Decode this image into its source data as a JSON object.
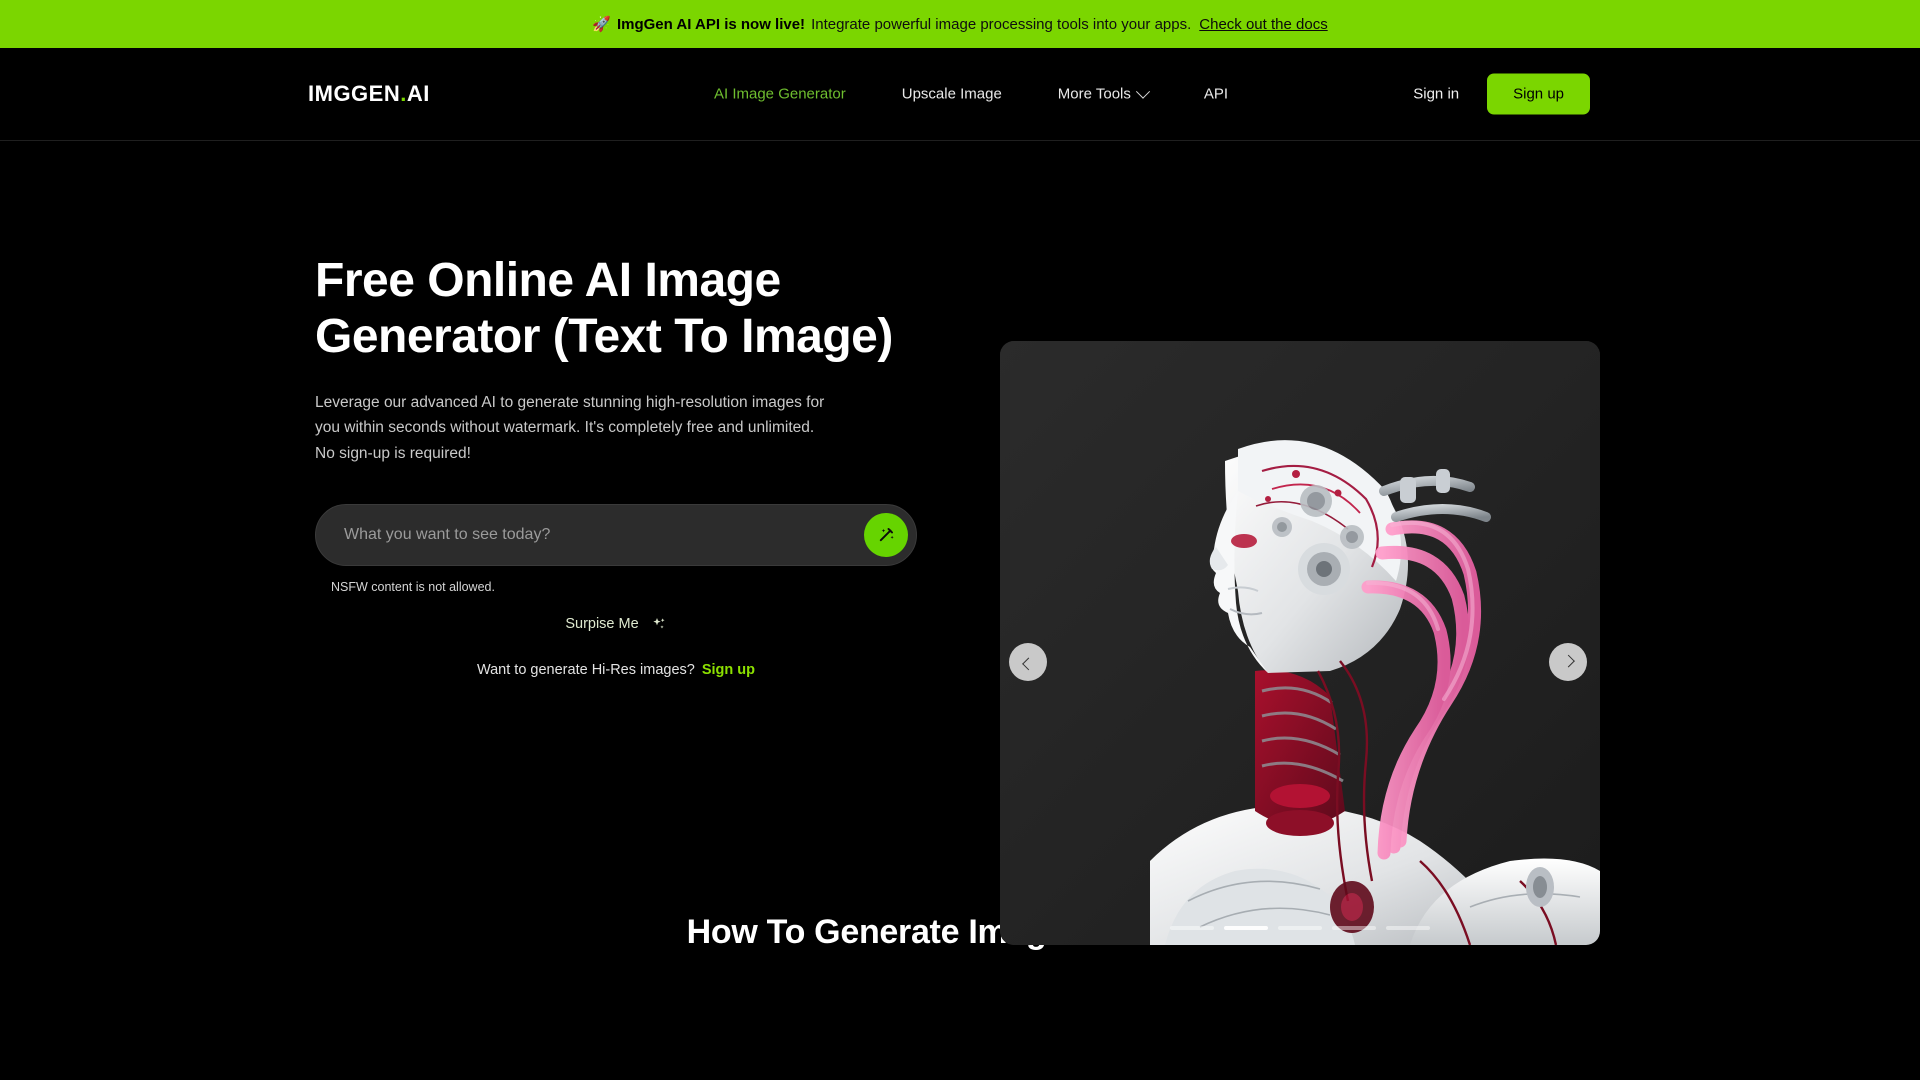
{
  "announcement": {
    "icon": "rocket-icon",
    "emoji": "🚀",
    "strong": "ImgGen AI API is now live!",
    "text": "Integrate powerful image processing tools into your apps.",
    "link": "Check out the docs",
    "background": "#7BD600"
  },
  "header": {
    "logo_main": "IMGGEN",
    "logo_dot": ".",
    "logo_suffix": "AI",
    "nav": [
      {
        "label": "AI Image Generator",
        "active": true,
        "has_chevron": false
      },
      {
        "label": "Upscale Image",
        "active": false,
        "has_chevron": false
      },
      {
        "label": "More Tools",
        "active": false,
        "has_chevron": true
      },
      {
        "label": "API",
        "active": false,
        "has_chevron": false
      }
    ],
    "sign_in": "Sign in",
    "sign_up": "Sign up",
    "accent_color": "#7BD600"
  },
  "hero": {
    "title": "Free Online AI Image Generator (Text To Image)",
    "subtitle": "Leverage our advanced AI to generate stunning high-resolution images for you within seconds without watermark. It's completely free and unlimited. No sign-up is required!",
    "prompt_placeholder": "What you want to see today?",
    "prompt_value": "",
    "generate_icon": "magic-wand-icon",
    "notice": "NSFW content is not allowed.",
    "surprise_label": "Surpise Me",
    "surprise_icon": "sparkles-icon",
    "hires_text": "Want to generate Hi-Res images?",
    "hires_link": "Sign up"
  },
  "carousel": {
    "prev_icon": "chevron-left-icon",
    "next_icon": "chevron-right-icon",
    "slide_count": 5,
    "active_slide": 1,
    "alt": "AI generated cyborg robot head with white plating and pink cables"
  },
  "howto": {
    "title": "How To Generate Image From Text"
  }
}
